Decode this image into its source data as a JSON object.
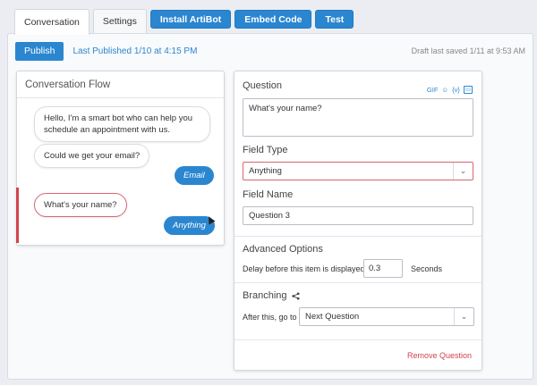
{
  "tabs": [
    {
      "label": "Conversation",
      "style": "active"
    },
    {
      "label": "Settings",
      "style": "plain"
    },
    {
      "label": "Install ArtiBot",
      "style": "blue"
    },
    {
      "label": "Embed Code",
      "style": "blue"
    },
    {
      "label": "Test",
      "style": "blue"
    }
  ],
  "toolbar": {
    "publish_label": "Publish",
    "last_published": "Last Published 1/10 at 4:15 PM",
    "draft_saved": "Draft last saved 1/11 at 9:53 AM"
  },
  "flow": {
    "title": "Conversation Flow",
    "messages": [
      "Hello, I'm a smart bot who can help you schedule an appointment with us.",
      "Could we get your email?",
      "What's your name?"
    ],
    "replies": [
      "Email",
      "Anything"
    ]
  },
  "question_panel": {
    "question_label": "Question",
    "media": {
      "gif": "GIF",
      "emoji": "☺",
      "variable": "{v}",
      "embed": "▭"
    },
    "question_value": "What's your name?",
    "field_type_label": "Field Type",
    "field_type_value": "Anything",
    "field_name_label": "Field Name",
    "field_name_value": "Question 3",
    "advanced_label": "Advanced Options",
    "delay_label": "Delay before this item is displayed",
    "delay_value": "0.3",
    "seconds_label": "Seconds",
    "branching_label": "Branching",
    "after_label": "After this, go to",
    "after_value": "Next Question",
    "remove_label": "Remove Question"
  },
  "colors": {
    "accent": "#2b86d0",
    "danger": "#d2434f"
  }
}
